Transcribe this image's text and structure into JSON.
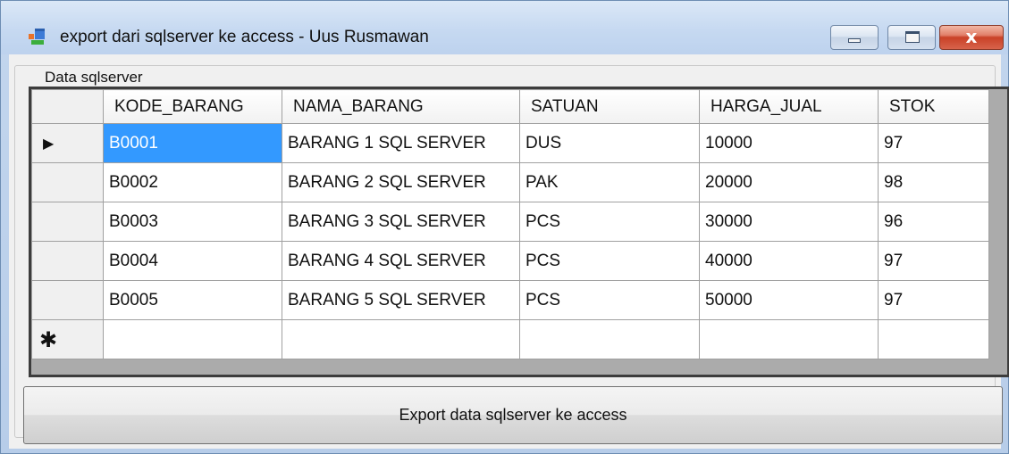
{
  "window": {
    "title": "export dari sqlserver ke access - Uus Rusmawan",
    "controls": {
      "minimize": "minimize",
      "maximize": "maximize",
      "close": "x"
    }
  },
  "group": {
    "label": "Data sqlserver"
  },
  "grid": {
    "columns": [
      "KODE_BARANG",
      "NAMA_BARANG",
      "SATUAN",
      "HARGA_JUAL",
      "STOK"
    ],
    "rows": [
      [
        "B0001",
        "BARANG 1 SQL SERVER",
        "DUS",
        "10000",
        "97"
      ],
      [
        "B0002",
        "BARANG 2 SQL SERVER",
        "PAK",
        "20000",
        "98"
      ],
      [
        "B0003",
        "BARANG 3 SQL SERVER",
        "PCS",
        "30000",
        "96"
      ],
      [
        "B0004",
        "BARANG 4 SQL SERVER",
        "PCS",
        "40000",
        "97"
      ],
      [
        "B0005",
        "BARANG 5 SQL SERVER",
        "PCS",
        "50000",
        "97"
      ]
    ],
    "current_row_marker": "▶",
    "new_row_marker": "✱",
    "selection_color": "#3399ff"
  },
  "export_button": {
    "label": "Export data sqlserver ke access"
  },
  "colors": {
    "close_button": "#c94127",
    "titlebar": "#c6d9f1"
  }
}
